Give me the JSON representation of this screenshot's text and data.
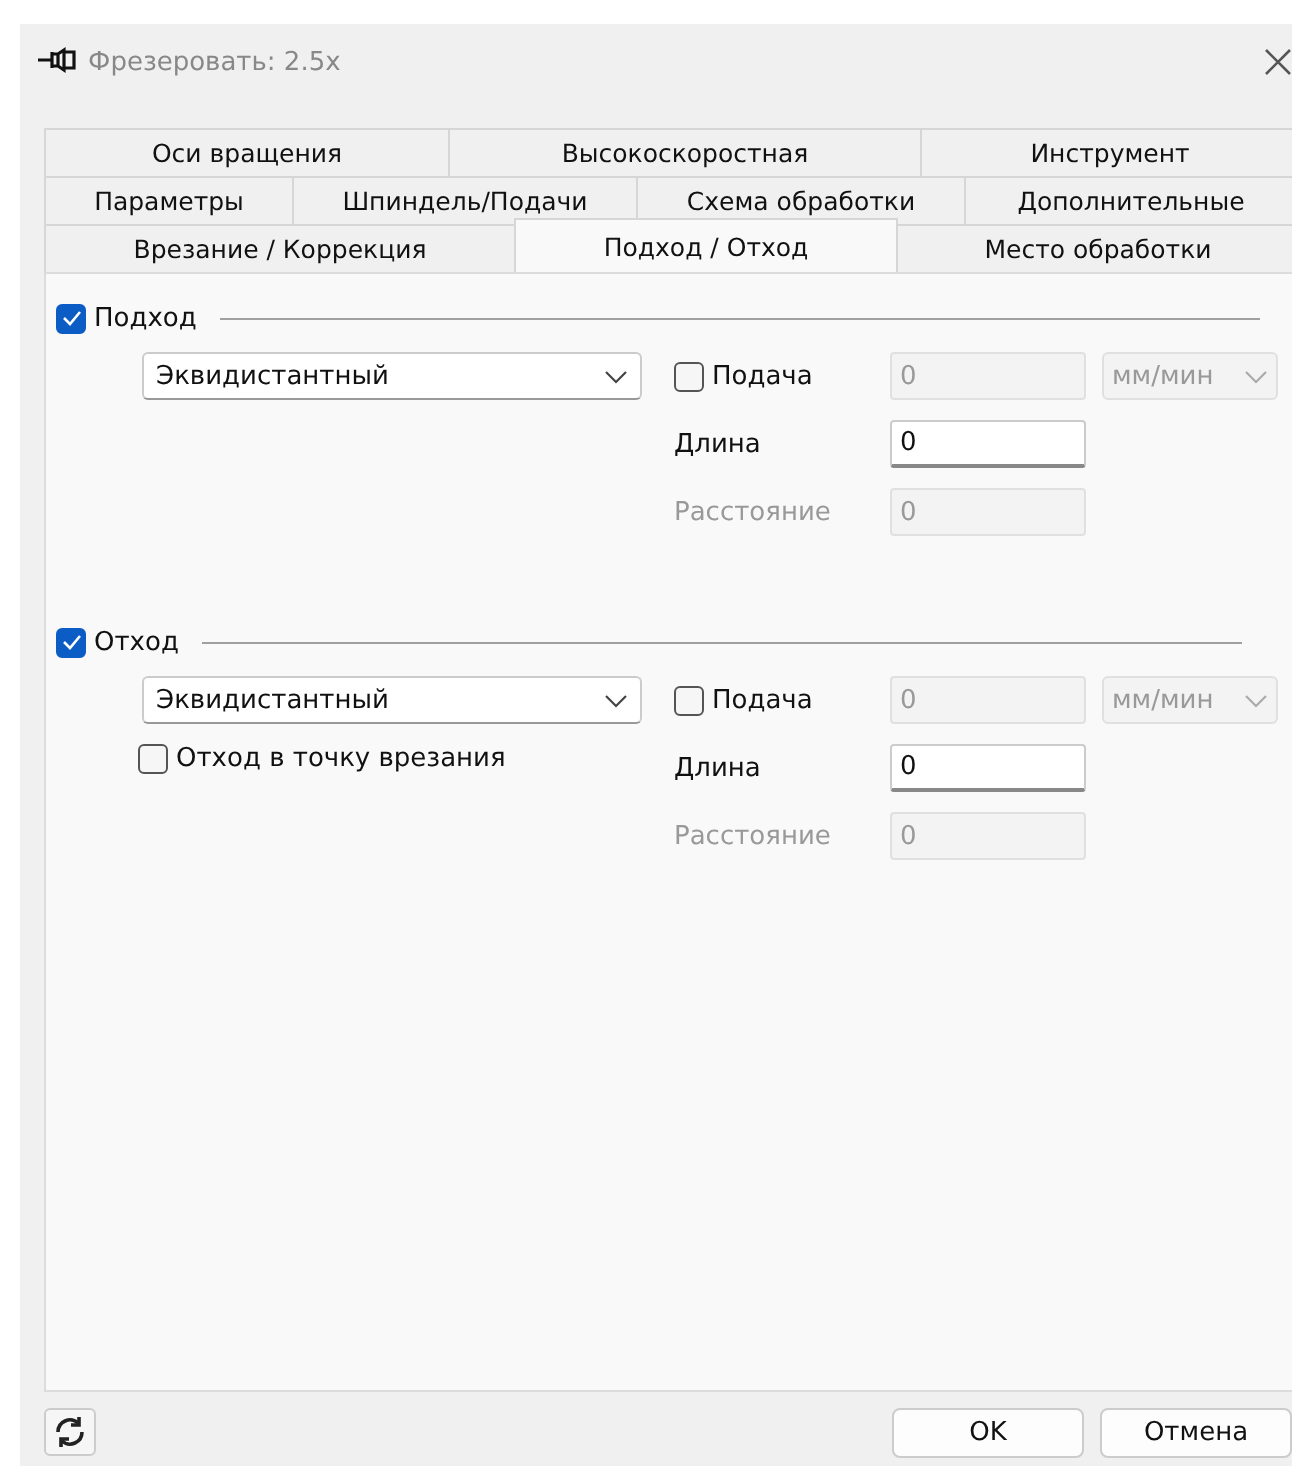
{
  "window": {
    "title": "Фрезеровать: 2.5x"
  },
  "tab_rows": [
    [
      {
        "label": "Оси вращения",
        "selected": false
      },
      {
        "label": "Высокоскоростная",
        "selected": false
      },
      {
        "label": "Инструмент",
        "selected": false
      }
    ],
    [
      {
        "label": "Параметры",
        "selected": false
      },
      {
        "label": "Шпиндель/Подачи",
        "selected": false
      },
      {
        "label": "Схема обработки",
        "selected": false
      },
      {
        "label": "Дополнительные",
        "selected": false
      }
    ],
    [
      {
        "label": "Врезание / Коррекция",
        "selected": false
      },
      {
        "label": "Подход / Отход",
        "selected": true
      },
      {
        "label": "Место обработки",
        "selected": false
      }
    ]
  ],
  "sections": [
    {
      "label": "Подход",
      "checked": true,
      "mode": "Эквидистантный",
      "feed": {
        "label": "Подача",
        "checked": false,
        "value": "0",
        "unit": "мм/мин"
      },
      "length": {
        "label": "Длина",
        "value": "0"
      },
      "distance": {
        "label": "Расстояние",
        "value": "0",
        "disabled": true
      }
    },
    {
      "label": "Отход",
      "checked": true,
      "mode": "Эквидистантный",
      "feed": {
        "label": "Подача",
        "checked": false,
        "value": "0",
        "unit": "мм/мин"
      },
      "length": {
        "label": "Длина",
        "value": "0"
      },
      "distance": {
        "label": "Расстояние",
        "value": "0",
        "disabled": true
      },
      "options": [
        {
          "label": "Отход в точку врезания",
          "checked": false
        }
      ]
    }
  ],
  "buttons": [
    "OK",
    "Отмена"
  ]
}
